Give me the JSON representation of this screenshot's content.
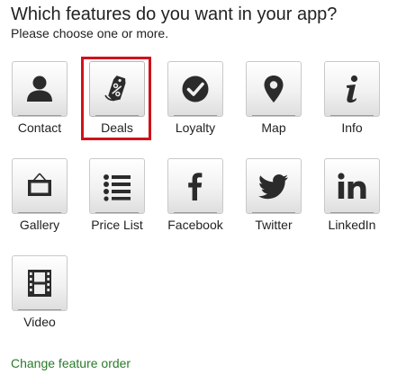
{
  "header": {
    "title": "Which features do you want in your app?",
    "subtitle": "Please choose one or more."
  },
  "features": [
    {
      "label": "Contact",
      "icon": "person-icon",
      "selected": false
    },
    {
      "label": "Deals",
      "icon": "coupon-tag-icon",
      "selected": true
    },
    {
      "label": "Loyalty",
      "icon": "checkmark-circle-icon",
      "selected": false
    },
    {
      "label": "Map",
      "icon": "map-pin-icon",
      "selected": false
    },
    {
      "label": "Info",
      "icon": "info-icon",
      "selected": false
    },
    {
      "label": "Gallery",
      "icon": "picture-frame-icon",
      "selected": false
    },
    {
      "label": "Price List",
      "icon": "list-icon",
      "selected": false
    },
    {
      "label": "Facebook",
      "icon": "facebook-icon",
      "selected": false
    },
    {
      "label": "Twitter",
      "icon": "twitter-bird-icon",
      "selected": false
    },
    {
      "label": "LinkedIn",
      "icon": "linkedin-icon",
      "selected": false
    },
    {
      "label": "Video",
      "icon": "film-icon",
      "selected": false
    }
  ],
  "footer": {
    "change_order_label": "Change feature order"
  },
  "colors": {
    "icon": "#2b2b2b",
    "selection_border": "#d0121b",
    "link": "#2a7a2a"
  }
}
